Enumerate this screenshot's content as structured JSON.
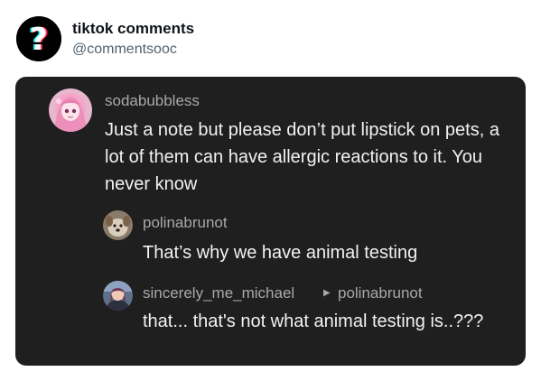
{
  "post": {
    "account_name": "tiktok comments",
    "handle": "@commentsooc"
  },
  "thread": {
    "comment": {
      "username": "sodabubbless",
      "text": "Just a note but please don’t put lipstick on pets, a lot of them can have allergic reactions to it. You never know",
      "avatar_icon": "anime-girl-pink-hair-avatar"
    },
    "replies": [
      {
        "username": "polinabrunot",
        "text": "That’s why we have animal testing",
        "avatar_icon": "dog-photo-avatar"
      },
      {
        "username": "sincerely_me_michael",
        "reply_to_arrow": "▶",
        "reply_to": "polinabrunot",
        "text": "that... that's not what animal testing is..???",
        "avatar_icon": "person-photo-avatar"
      }
    ]
  },
  "colors": {
    "card_background": "#1f1f1f",
    "username_gray": "#a8a8a8",
    "comment_text": "#f2f2f2",
    "logo_cyan": "#25f4ee",
    "logo_pink": "#fe2c55"
  }
}
